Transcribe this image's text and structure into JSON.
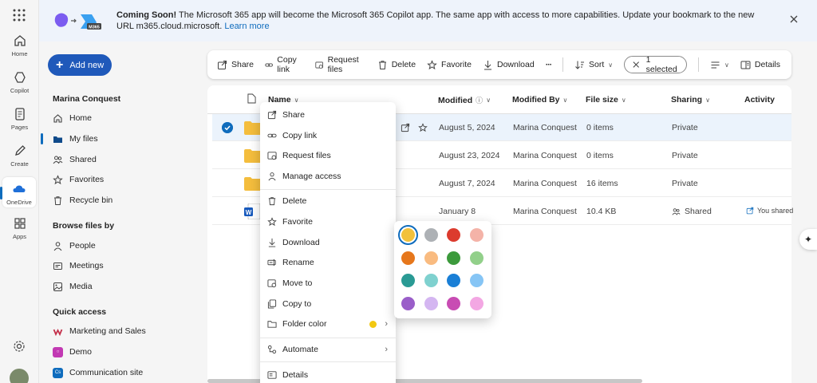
{
  "banner": {
    "title": "Coming Soon!",
    "message": "The Microsoft 365 app will become the Microsoft 365 Copilot app. The same app with access to more capabilities. Update your bookmark to the new URL m365.cloud.microsoft.",
    "link": "Learn more",
    "logo_badge": "M365"
  },
  "rail": {
    "items": [
      {
        "label": "Home",
        "icon": "home-icon"
      },
      {
        "label": "Copilot",
        "icon": "copilot-icon"
      },
      {
        "label": "Pages",
        "icon": "pages-icon"
      },
      {
        "label": "Create",
        "icon": "pen-icon"
      },
      {
        "label": "OneDrive",
        "icon": "onedrive-icon"
      },
      {
        "label": "Apps",
        "icon": "apps-icon"
      }
    ]
  },
  "nav": {
    "add_new": "Add new",
    "user_section": "Marina Conquest",
    "items": [
      "Home",
      "My files",
      "Shared",
      "Favorites",
      "Recycle bin"
    ],
    "browse_section": "Browse files by",
    "browse": [
      "People",
      "Meetings",
      "Media"
    ],
    "quick_section": "Quick access",
    "quick": [
      {
        "label": "Marketing and Sales",
        "badge": "",
        "color": "#c4314b"
      },
      {
        "label": "Demo",
        "badge": "○",
        "color": "#c239b3"
      },
      {
        "label": "Communication site",
        "badge": "Cs",
        "color": "#0f6cbd"
      }
    ]
  },
  "toolbar": {
    "share": "Share",
    "copy_link": "Copy link",
    "request_files": "Request files",
    "delete": "Delete",
    "favorite": "Favorite",
    "download": "Download",
    "more": "···",
    "sort": "Sort",
    "selected": "1 selected",
    "details": "Details"
  },
  "table": {
    "columns": {
      "name": "Name",
      "modified": "Modified",
      "modified_by": "Modified By",
      "file_size": "File size",
      "sharing": "Sharing",
      "activity": "Activity"
    },
    "rows": [
      {
        "modified": "August 5, 2024",
        "by": "Marina Conquest",
        "size": "0 items",
        "sharing": "Private",
        "activity": ""
      },
      {
        "modified": "August 23, 2024",
        "by": "Marina Conquest",
        "size": "0 items",
        "sharing": "Private",
        "activity": ""
      },
      {
        "modified": "August 7, 2024",
        "by": "Marina Conquest",
        "size": "16 items",
        "sharing": "Private",
        "activity": ""
      },
      {
        "modified": "January 8",
        "by": "Marina Conquest",
        "size": "10.4 KB",
        "sharing": "Shared",
        "activity": "You shared"
      }
    ]
  },
  "context_menu": {
    "items": [
      "Share",
      "Copy link",
      "Request files",
      "Manage access",
      "Delete",
      "Favorite",
      "Download",
      "Rename",
      "Move to",
      "Copy to",
      "Folder color",
      "Automate",
      "Details"
    ]
  },
  "folder_colors": [
    "#f2c13c",
    "#adb1b5",
    "#dc3b2e",
    "#f4b3a8",
    "#e6771c",
    "#f9bb80",
    "#3c9a3c",
    "#92d08a",
    "#2a9a94",
    "#7fd1cf",
    "#1a7fd6",
    "#86c5f5",
    "#9a5ec9",
    "#d4b6f1",
    "#c84cb3",
    "#f3a7e3"
  ]
}
